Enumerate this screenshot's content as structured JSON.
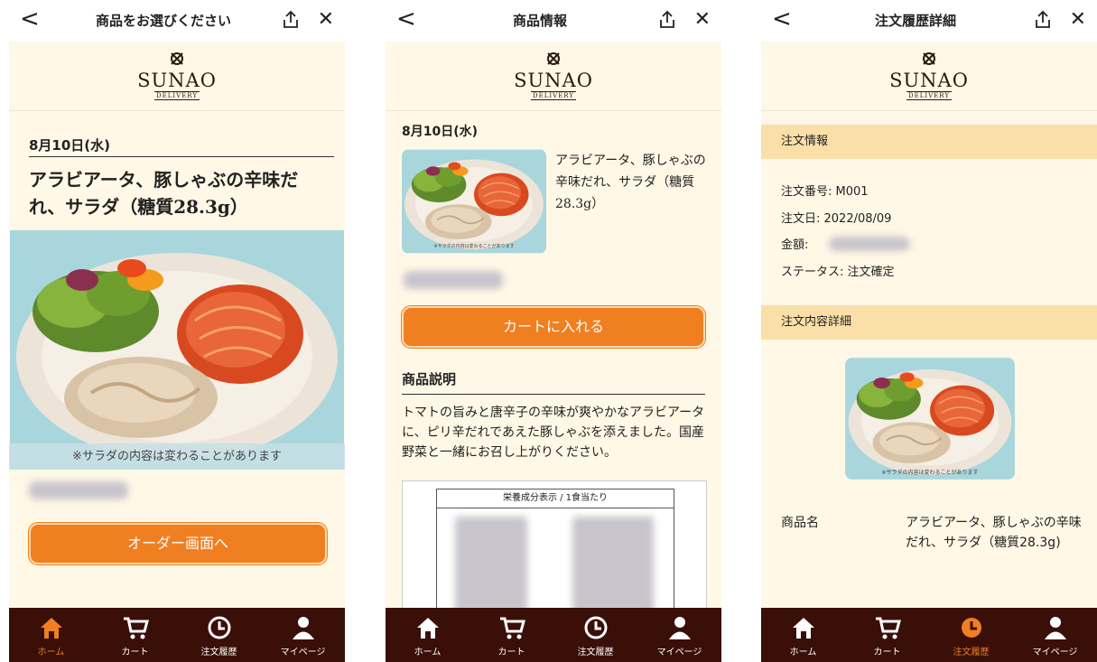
{
  "common": {
    "back_glyph": "<",
    "close_glyph": "✕",
    "brand": "SUNAO",
    "brand_sub": "DELIVERY",
    "tabs": [
      "ホーム",
      "カート",
      "注文履歴",
      "マイページ"
    ]
  },
  "screen1": {
    "title": "商品をお選びください",
    "date": "8月10日(水)",
    "product_name": "アラビアータ、豚しゃぶの辛味だれ、サラダ（糖質28.3g）",
    "photo_caption": "※サラダの内容は変わることがあります",
    "order_button": "オーダー画面へ",
    "active_tab": 0
  },
  "screen2": {
    "title": "商品情報",
    "date": "8月10日(水)",
    "product_name": "アラビアータ、豚しゃぶの辛味だれ、サラダ（糖質28.3g）",
    "photo_caption": "※サラダの内容は変わることがあります",
    "cart_button": "カートに入れる",
    "section_title": "商品説明",
    "description": "トマトの旨みと唐辛子の辛味が爽やかなアラビアータに、ピリ辛だれであえた豚しゃぶを添えました。国産野菜と一緒にお召し上がりください。",
    "nutrition_header": "栄養成分表示 / 1食当たり"
  },
  "screen3": {
    "title": "注文履歴詳細",
    "order_info_heading": "注文情報",
    "order_number": "注文番号: M001",
    "order_date": "注文日: 2022/08/09",
    "amount_label": "金額:",
    "status": "ステータス: 注文確定",
    "detail_heading": "注文内容詳細",
    "photo_caption": "※サラダの内容は変わることがあります",
    "product_label": "商品名",
    "product_value": "アラビアータ、豚しゃぶの辛味だれ、サラダ（糖質28.3g)",
    "active_tab": 2
  },
  "colors": {
    "accent": "#f07f21",
    "background": "#fff8e6",
    "tabbar": "#3a0f08",
    "band": "#fbdfa8"
  }
}
